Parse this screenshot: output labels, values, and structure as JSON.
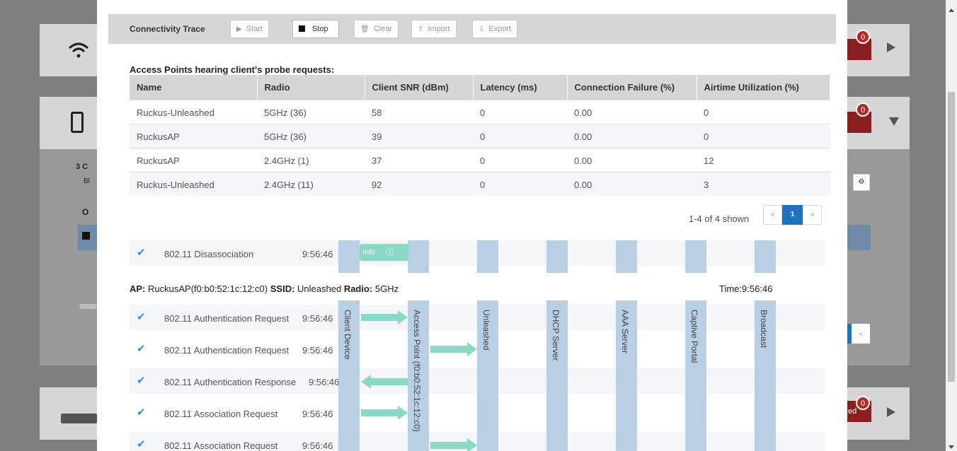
{
  "toolbar": {
    "title": "Connectivity Trace",
    "start": "Start",
    "stop": "Stop",
    "clear": "Clear",
    "import": "Import",
    "export": "Export"
  },
  "ap_section": {
    "title": "Access Points hearing client's probe requests:",
    "columns": [
      "Name",
      "Radio",
      "Client SNR (dBm)",
      "Latency (ms)",
      "Connection Failure (%)",
      "Airtime Utilization (%)"
    ],
    "rows": [
      [
        "Ruckus-Unleashed",
        "5GHz (36)",
        "58",
        "0",
        "0.00",
        "0"
      ],
      [
        "RuckusAP",
        "5GHz (36)",
        "39",
        "0",
        "0.00",
        "0"
      ],
      [
        "RuckusAP",
        "2.4GHz (1)",
        "37",
        "0",
        "0.00",
        "12"
      ],
      [
        "Ruckus-Unleashed",
        "2.4GHz (11)",
        "92",
        "0",
        "0.00",
        "3"
      ]
    ]
  },
  "pagination": {
    "summary": "1-4 of 4 shown",
    "prev": "«",
    "page": "1",
    "next": "»"
  },
  "pre_event": {
    "label": "802.11 Disassociation",
    "time": "9:56:46",
    "info": "Info"
  },
  "ap_info": {
    "ap_label": "AP:",
    "ap_value": "RuckusAP(f0:b0:52:1c:12:c0)",
    "ssid_label": "SSID:",
    "ssid_value": "Unleashed",
    "radio_label": "Radio:",
    "radio_value": "5GHz",
    "time": "Time:9:56:46"
  },
  "lanes": [
    "Client Device",
    "Access Point (f0:b0:52:1c:12:c0)",
    "Unleashed",
    "DHCP Server",
    "AAA Server",
    "Captive Portal",
    "Broadcast"
  ],
  "events": [
    {
      "label": "802.11 Authentication Request",
      "time": "9:56:46"
    },
    {
      "label": "802.11 Authentication Request",
      "time": "9:56:46"
    },
    {
      "label": "802.11 Authentication Response",
      "time": "9:56:46"
    },
    {
      "label": "802.11 Association Request",
      "time": "9:56:46"
    },
    {
      "label": "802.11 Association Request",
      "time": "9:56:46"
    }
  ],
  "background": {
    "badges": [
      "0",
      "0",
      "0"
    ],
    "clients_prefix": "3 C",
    "bl_text": "Bl",
    "o_text": "O",
    "ed_text": "ed"
  }
}
